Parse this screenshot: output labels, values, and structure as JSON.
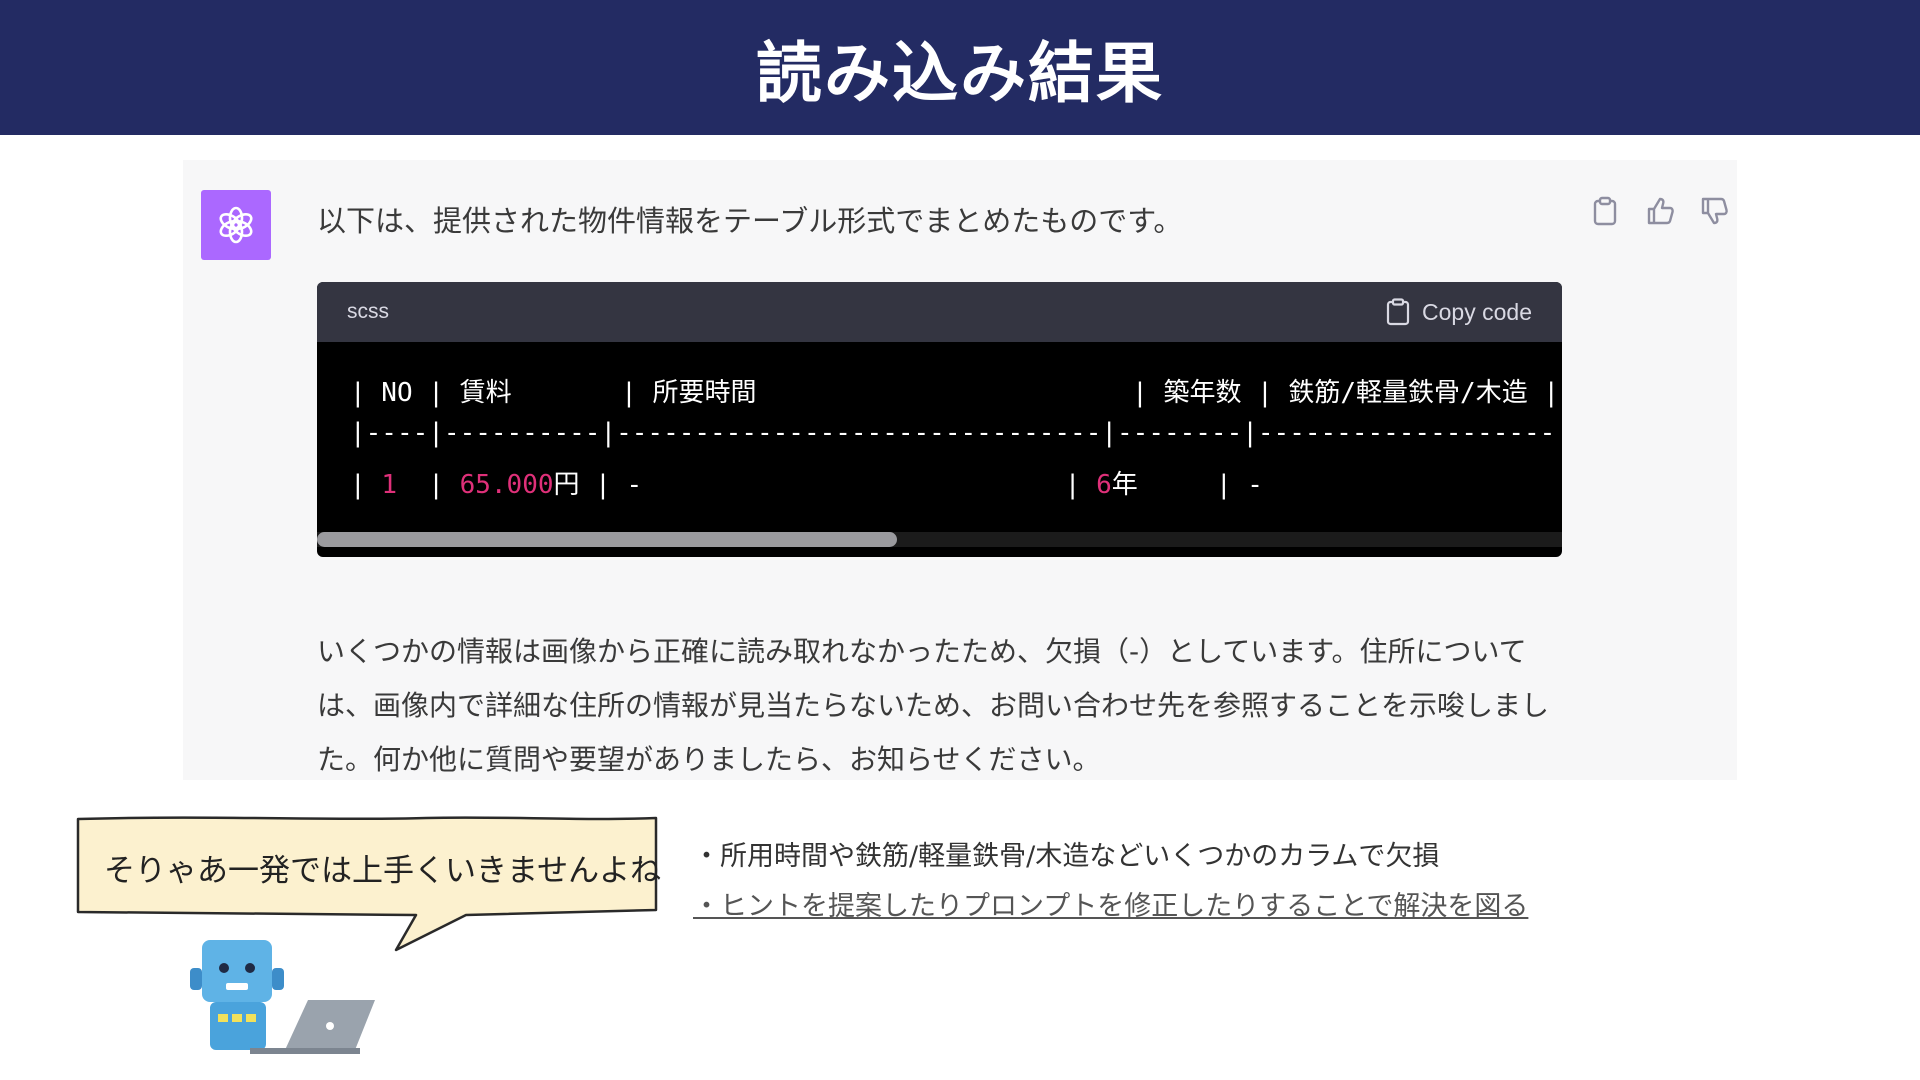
{
  "header": {
    "title": "読み込み結果"
  },
  "chat": {
    "intro": "以下は、提供された物件情報をテーブル形式でまとめたものです。",
    "code": {
      "language": "scss",
      "copy_label": "Copy code",
      "line1": "| NO | 賃料       | 所要時間                        | 築年数 | 鉄筋/軽量鉄骨/木造 |",
      "line2": "|----|----------|-------------------------------|--------|-------------------",
      "row": {
        "p1": "| ",
        "no": "1",
        "p2": "  | ",
        "rent": "65.000",
        "p3": "円 | -                           | ",
        "age": "6",
        "p4": "年     | -"
      }
    },
    "result": "いくつかの情報は画像から正確に読み取れなかったため、欠損（-）としています。住所については、画像内で詳細な住所の情報が見当たらないため、お問い合わせ先を参照することを示唆しました。何か他に質問や要望がありましたら、お知らせください。"
  },
  "bubble": {
    "text": "そりゃあ一発では上手くいきませんよね"
  },
  "notes": [
    "・所用時間や鉄筋/軽量鉄骨/木造などいくつかのカラムで欠損",
    "・ヒントを提案したりプロンプトを修正したりすることで解決を図る"
  ],
  "colors": {
    "header_bg": "#232b63",
    "avatar_bg": "#ab68ff",
    "code_number": "#df3079",
    "bubble_fill": "#fcf1cf"
  },
  "icons": [
    "openai-logo-icon",
    "clipboard-icon",
    "thumbs-up-icon",
    "thumbs-down-icon",
    "robot-laptop-icon"
  ]
}
